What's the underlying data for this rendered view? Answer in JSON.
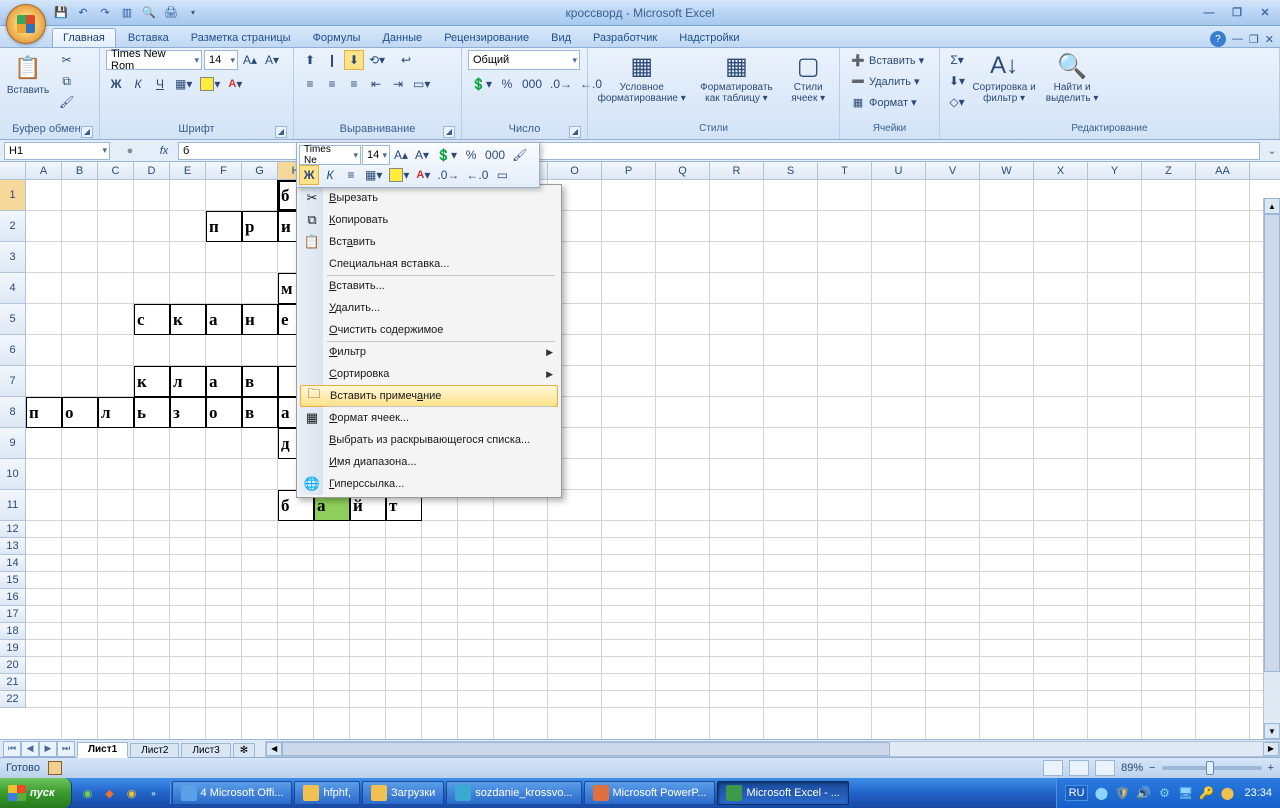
{
  "app": {
    "title": "кроссворд - Microsoft Excel"
  },
  "tabs": [
    "Главная",
    "Вставка",
    "Разметка страницы",
    "Формулы",
    "Данные",
    "Рецензирование",
    "Вид",
    "Разработчик",
    "Надстройки"
  ],
  "active_tab": 0,
  "ribbon": {
    "clipboard": {
      "label": "Буфер обмена",
      "paste": "Вставить"
    },
    "font": {
      "label": "Шрифт",
      "family": "Times New Rom",
      "size": "14"
    },
    "align": {
      "label": "Выравнивание"
    },
    "number": {
      "label": "Число",
      "format": "Общий"
    },
    "styles": {
      "label": "Стили",
      "cond": "Условное форматирование ▾",
      "table": "Форматировать как таблицу ▾",
      "cell": "Стили ячеек ▾"
    },
    "cells": {
      "label": "Ячейки",
      "insert": "Вставить ▾",
      "delete": "Удалить ▾",
      "format": "Формат ▾"
    },
    "editing": {
      "label": "Редактирование",
      "sort": "Сортировка и фильтр ▾",
      "find": "Найти и выделить ▾"
    }
  },
  "formula_bar": {
    "cell_ref": "H1",
    "value": "б"
  },
  "columns": [
    "A",
    "B",
    "C",
    "D",
    "E",
    "F",
    "G",
    "H",
    "I",
    "J",
    "K",
    "L",
    "M",
    "N",
    "O",
    "P",
    "Q",
    "R",
    "S",
    "T",
    "U",
    "V",
    "W",
    "X",
    "Y",
    "Z",
    "AA"
  ],
  "sel_col": "H",
  "rows_tall": [
    1,
    2,
    3,
    4,
    5,
    6,
    7,
    8,
    9,
    10,
    11
  ],
  "rows_short": [
    12,
    13,
    14,
    15,
    16,
    17,
    18,
    19,
    20,
    21,
    22
  ],
  "sel_row": 1,
  "cells": [
    {
      "r": 1,
      "c": "H",
      "v": "б"
    },
    {
      "r": 1,
      "c": "I",
      "v": "",
      "green": true
    },
    {
      "r": 2,
      "c": "F",
      "v": "п"
    },
    {
      "r": 2,
      "c": "G",
      "v": "р"
    },
    {
      "r": 2,
      "c": "H",
      "v": "и"
    },
    {
      "r": 4,
      "c": "H",
      "v": "м"
    },
    {
      "r": 5,
      "c": "D",
      "v": "с"
    },
    {
      "r": 5,
      "c": "E",
      "v": "к"
    },
    {
      "r": 5,
      "c": "F",
      "v": "а"
    },
    {
      "r": 5,
      "c": "G",
      "v": "н"
    },
    {
      "r": 5,
      "c": "H",
      "v": "е"
    },
    {
      "r": 7,
      "c": "D",
      "v": "к"
    },
    {
      "r": 7,
      "c": "E",
      "v": "л"
    },
    {
      "r": 7,
      "c": "F",
      "v": "а"
    },
    {
      "r": 7,
      "c": "G",
      "v": "в"
    },
    {
      "r": 7,
      "c": "H",
      "v": ""
    },
    {
      "r": 8,
      "c": "A",
      "v": "п"
    },
    {
      "r": 8,
      "c": "B",
      "v": "о"
    },
    {
      "r": 8,
      "c": "C",
      "v": "л"
    },
    {
      "r": 8,
      "c": "D",
      "v": "ь"
    },
    {
      "r": 8,
      "c": "E",
      "v": "з"
    },
    {
      "r": 8,
      "c": "F",
      "v": "о"
    },
    {
      "r": 8,
      "c": "G",
      "v": "в"
    },
    {
      "r": 8,
      "c": "H",
      "v": "а"
    },
    {
      "r": 9,
      "c": "H",
      "v": "д"
    },
    {
      "r": 11,
      "c": "H",
      "v": "б"
    },
    {
      "r": 11,
      "c": "I",
      "v": "а",
      "green": true
    },
    {
      "r": 11,
      "c": "J",
      "v": "й"
    },
    {
      "r": 11,
      "c": "K",
      "v": "т"
    }
  ],
  "minitoolbar": {
    "font": "Times Ne",
    "size": "14"
  },
  "context_menu": [
    {
      "label": "Вырезать",
      "u": 0,
      "icon": "✂"
    },
    {
      "label": "Копировать",
      "u": 0,
      "icon": "⧉"
    },
    {
      "label": "Вставить",
      "u": 3,
      "icon": "📋"
    },
    {
      "label": "Специальная вставка...",
      "sep": true
    },
    {
      "label": "Вставить...",
      "u": 0
    },
    {
      "label": "Удалить...",
      "u": 0
    },
    {
      "label": "Очистить содержимое",
      "u": 0,
      "sep": true
    },
    {
      "label": "Фильтр",
      "u": 0,
      "sub": true
    },
    {
      "label": "Сортировка",
      "u": 0,
      "sub": true,
      "sep": true
    },
    {
      "label": "Вставить примечание",
      "u": 15,
      "icon": "🗀",
      "hl": true,
      "sep": true
    },
    {
      "label": "Формат ячеек...",
      "u": 0,
      "icon": "▦"
    },
    {
      "label": "Выбрать из раскрывающегося списка...",
      "u": 0
    },
    {
      "label": "Имя диапазона...",
      "u": 0
    },
    {
      "label": "Гиперссылка...",
      "u": 0,
      "icon": "🌐"
    }
  ],
  "sheets": [
    "Лист1",
    "Лист2",
    "Лист3"
  ],
  "active_sheet": 0,
  "status": {
    "text": "Готово",
    "zoom": "89%"
  },
  "taskbar": {
    "start": "пуск",
    "buttons": [
      {
        "label": "4 Microsoft Offi...",
        "color": "#5aa0e6"
      },
      {
        "label": "hfphf,",
        "color": "#f0c050"
      },
      {
        "label": "Загрузки",
        "color": "#f0c050"
      },
      {
        "label": "sozdanie_krossvo...",
        "color": "#3aaad0"
      },
      {
        "label": "Microsoft PowerP...",
        "color": "#e07040"
      },
      {
        "label": "Microsoft Excel - ...",
        "color": "#3a9a4a",
        "active": true
      }
    ],
    "lang": "RU",
    "time": "23:34"
  }
}
